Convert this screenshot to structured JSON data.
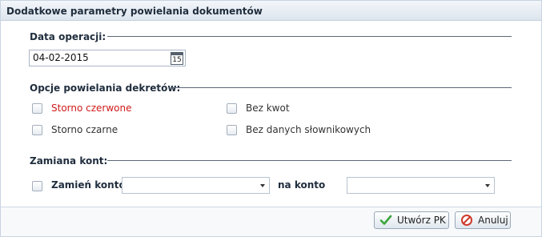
{
  "window": {
    "title": "Dodatkowe parametry powielania dokumentów"
  },
  "date_section": {
    "legend": "Data operacji:",
    "date_value": "04-02-2015",
    "calendar_day": "15"
  },
  "options_section": {
    "legend": "Opcje powielania dekretów:",
    "storno_czerwone": "Storno czerwone",
    "storno_czarne": "Storno czarne",
    "bez_kwot": "Bez kwot",
    "bez_danych": "Bez danych słownikowych"
  },
  "accounts_section": {
    "legend": "Zamiana kont:",
    "zamien_label": "Zamień konto",
    "na_konto_label": "na konto"
  },
  "buttons": {
    "create_label": "Utwórz PK",
    "cancel_label": "Anuluj"
  },
  "colors": {
    "accent_red": "#d11a1a",
    "ok_green": "#3aa63a",
    "cancel_red": "#d03a2a"
  }
}
